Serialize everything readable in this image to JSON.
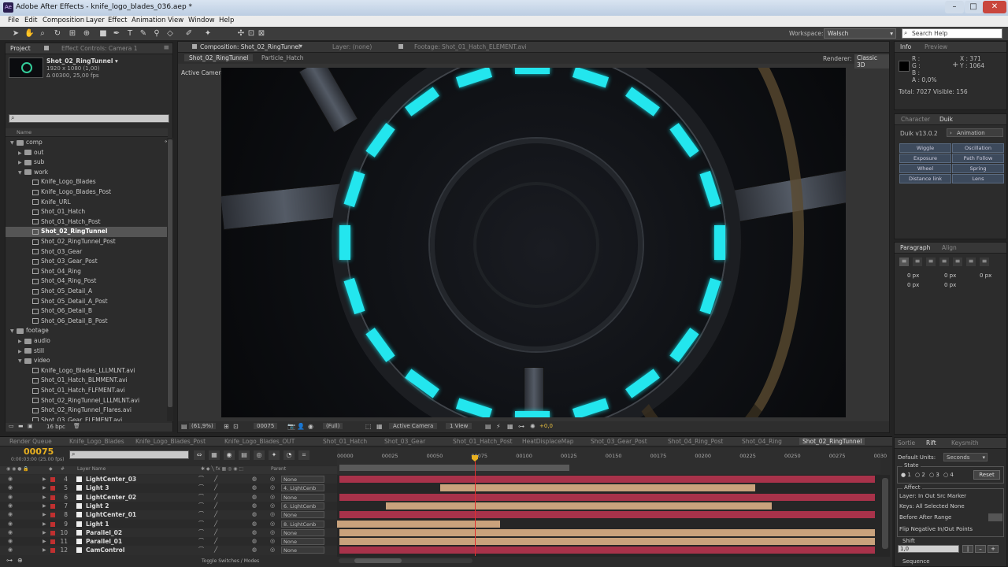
{
  "window": {
    "title": "Adobe After Effects - knife_logo_blades_036.aep *",
    "app_icon": "Ae"
  },
  "menu": [
    "File",
    "Edit",
    "Composition",
    "Layer",
    "Effect",
    "Animation",
    "View",
    "Window",
    "Help"
  ],
  "toolbar": {
    "workspace_label": "Workspace:",
    "workspace_value": "Walsch",
    "search_placeholder": "Search Help"
  },
  "project": {
    "tabs": [
      "Project",
      "Effect Controls: Camera 1"
    ],
    "comp_name": "Shot_02_RingTunnel ▾",
    "comp_res": "1920 x 1080 (1,00)",
    "comp_dur": "Δ 00300, 25,00 fps",
    "col_name": "Name",
    "bpc": "16 bpc",
    "tree": [
      {
        "level": 0,
        "type": "folder",
        "label": "comp"
      },
      {
        "level": 1,
        "type": "folder",
        "label": "out"
      },
      {
        "level": 1,
        "type": "folder",
        "label": "sub"
      },
      {
        "level": 1,
        "type": "folder",
        "label": "work"
      },
      {
        "level": 2,
        "type": "comp",
        "label": "Knife_Logo_Blades"
      },
      {
        "level": 2,
        "type": "comp",
        "label": "Knife_Logo_Blades_Post"
      },
      {
        "level": 2,
        "type": "comp",
        "label": "Knife_URL"
      },
      {
        "level": 2,
        "type": "comp",
        "label": "Shot_01_Hatch"
      },
      {
        "level": 2,
        "type": "comp",
        "label": "Shot_01_Hatch_Post"
      },
      {
        "level": 2,
        "type": "comp",
        "label": "Shot_02_RingTunnel",
        "selected": true
      },
      {
        "level": 2,
        "type": "comp",
        "label": "Shot_02_RingTunnel_Post"
      },
      {
        "level": 2,
        "type": "comp",
        "label": "Shot_03_Gear"
      },
      {
        "level": 2,
        "type": "comp",
        "label": "Shot_03_Gear_Post"
      },
      {
        "level": 2,
        "type": "comp",
        "label": "Shot_04_Ring"
      },
      {
        "level": 2,
        "type": "comp",
        "label": "Shot_04_Ring_Post"
      },
      {
        "level": 2,
        "type": "comp",
        "label": "Shot_05_Detail_A"
      },
      {
        "level": 2,
        "type": "comp",
        "label": "Shot_05_Detail_A_Post"
      },
      {
        "level": 2,
        "type": "comp",
        "label": "Shot_06_Detail_B"
      },
      {
        "level": 2,
        "type": "comp",
        "label": "Shot_06_Detail_B_Post"
      },
      {
        "level": 0,
        "type": "folder",
        "label": "footage"
      },
      {
        "level": 1,
        "type": "folder",
        "label": "audio"
      },
      {
        "level": 1,
        "type": "folder",
        "label": "still"
      },
      {
        "level": 1,
        "type": "folder",
        "label": "video"
      },
      {
        "level": 2,
        "type": "comp",
        "label": "Knife_Logo_Blades_LLLMLNT.avi"
      },
      {
        "level": 2,
        "type": "comp",
        "label": "Shot_01_Hatch_BLMMENT.avi"
      },
      {
        "level": 2,
        "type": "comp",
        "label": "Shot_01_Hatch_FLFMENT.avi"
      },
      {
        "level": 2,
        "type": "comp",
        "label": "Shot_02_RingTunnel_LLLMLNT.avi"
      },
      {
        "level": 2,
        "type": "comp",
        "label": "Shot_02_RingTunnel_Flares.avi"
      },
      {
        "level": 2,
        "type": "comp",
        "label": "Shot_03_Gear_FLEMENT.avi"
      }
    ]
  },
  "comp_panel": {
    "tabs": [
      "Composition: Shot_02_RingTunnel",
      "Layer: (none)",
      "Footage: Shot_01_Hatch_ELEMENT.avi"
    ],
    "subtabs": [
      "Shot_02_RingTunnel",
      "Particle_Hatch"
    ],
    "renderer_label": "Renderer:",
    "renderer_value": "Classic 3D",
    "active_camera": "Active Camera",
    "footer": {
      "zoom": "(61,9%)",
      "frame": "00075",
      "res": "(Full)",
      "view": "Active Camera",
      "views": "1 View",
      "exposure": "+0,0"
    }
  },
  "info": {
    "tabs": [
      "Info",
      "Preview"
    ],
    "r": "R :",
    "g": "G :",
    "b": "B :",
    "a": "A : 0,0%",
    "x": "X : 371",
    "y": "Y : 1064",
    "total": "Total: 7027  Visible: 156"
  },
  "duik": {
    "tabs": [
      "Character",
      "Duik"
    ],
    "version": "Duik v13.0.2",
    "mode": "Animation",
    "buttons": [
      "Wiggle",
      "Oscillation",
      "Exposure",
      "Path Follow",
      "Wheel",
      "Spring",
      "Distance link",
      "Lens"
    ]
  },
  "paragraph": {
    "tabs": [
      "Paragraph",
      "Align"
    ],
    "fields": [
      "0 px",
      "0 px",
      "0 px",
      "0 px",
      "0 px"
    ]
  },
  "timeline": {
    "tabs": [
      "Render Queue",
      "Knife_Logo_Blades",
      "Knife_Logo_Blades_Post",
      "Knife_Logo_Blades_OUT",
      "Shot_01_Hatch",
      "Shot_03_Gear",
      "Shot_01_Hatch_Post",
      "HeatDisplaceMap",
      "Shot_03_Gear_Post",
      "Shot_04_Ring_Post",
      "Shot_04_Ring",
      "Shot_02_RingTunnel"
    ],
    "timecode": "00075",
    "timecode_sub": "0:00:03:00 (25.00 fps)",
    "col_hash": "#",
    "col_layer": "Layer Name",
    "col_parent": "Parent",
    "ruler": [
      "00000",
      "00025",
      "00050",
      "00075",
      "00100",
      "00125",
      "00150",
      "00175",
      "00200",
      "00225",
      "00250",
      "00275",
      "0030"
    ],
    "toggle_label": "Toggle Switches / Modes",
    "layers": [
      {
        "num": "4",
        "name": "LightCenter_03",
        "color": "#c03030",
        "parent": "None"
      },
      {
        "num": "5",
        "name": "Light 3",
        "color": "#c03030",
        "parent": "4. LightCenb"
      },
      {
        "num": "6",
        "name": "LightCenter_02",
        "color": "#c03030",
        "parent": "None"
      },
      {
        "num": "7",
        "name": "Light 2",
        "color": "#c03030",
        "parent": "6. LightCenb"
      },
      {
        "num": "8",
        "name": "LightCenter_01",
        "color": "#c03030",
        "parent": "None"
      },
      {
        "num": "9",
        "name": "Light 1",
        "color": "#c03030",
        "parent": "8. LightCenb"
      },
      {
        "num": "10",
        "name": "Parallel_02",
        "color": "#c03030",
        "parent": "None"
      },
      {
        "num": "11",
        "name": "Parallel_01",
        "color": "#c03030",
        "parent": "None"
      },
      {
        "num": "12",
        "name": "CamControl",
        "color": "#c03030",
        "parent": "None"
      }
    ]
  },
  "rift": {
    "tabs": [
      "Sortie",
      "Rift",
      "Keysmith"
    ],
    "default_units_label": "Default Units:",
    "default_units_value": "Seconds",
    "state_label": "State",
    "state_options": [
      "1",
      "2",
      "3",
      "4"
    ],
    "reset": "Reset",
    "affect_label": "Affect",
    "layer_row": "Layer:  In   Out   Src   Marker",
    "keys_row": "Keys:  All   Selected   None",
    "before_row": "Before   After   Range",
    "flip_row": "Flip Negative In/Out Points",
    "shift_label": "Shift",
    "shift_value": "1,0",
    "sequence_label": "Sequence"
  }
}
